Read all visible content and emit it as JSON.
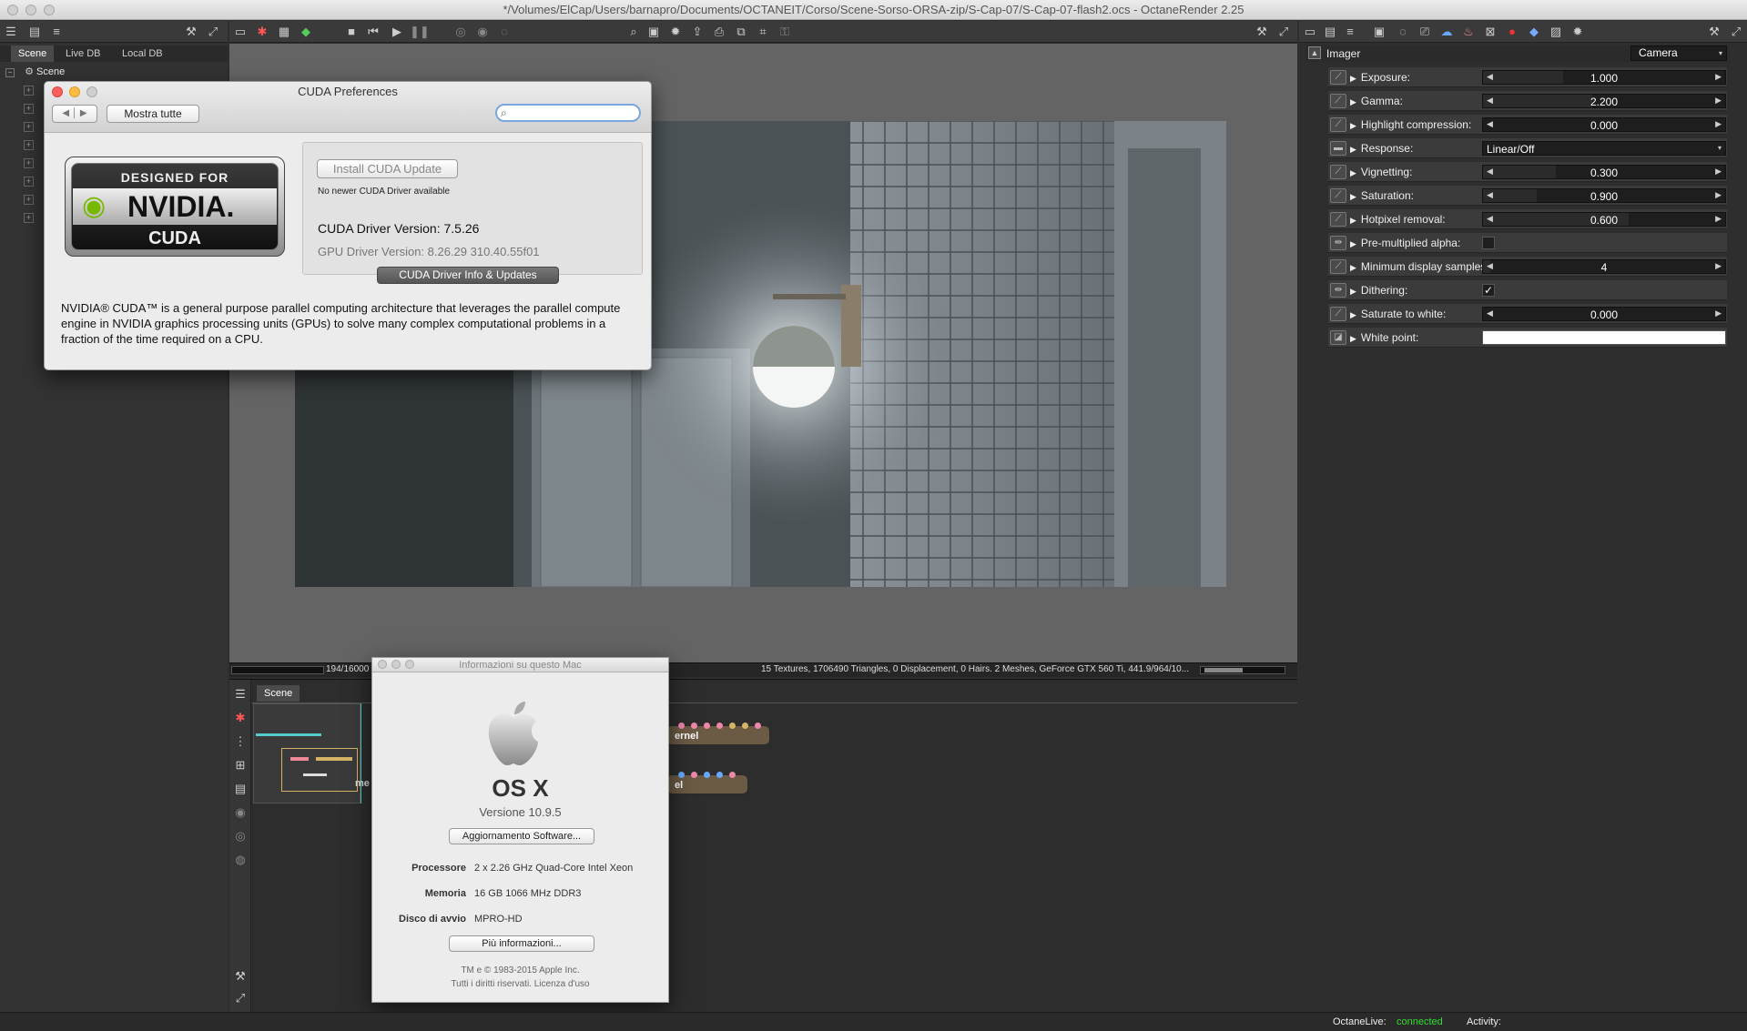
{
  "window": {
    "title": "*/Volumes/ElCap/Users/barnapro/Documents/OCTANEIT/Corso/Scene-Sorso-ORSA-zip/S-Cap-07/S-Cap-07-flash2.ocs - OctaneRender 2.25"
  },
  "scene_panel": {
    "tabs": [
      {
        "label": "Scene"
      },
      {
        "label": "Live DB"
      },
      {
        "label": "Local DB"
      }
    ],
    "root": "Scene"
  },
  "cuda_prefs": {
    "title": "CUDA Preferences",
    "show_all": "Mostra tutte",
    "search_placeholder": "",
    "logo": {
      "top": "DESIGNED FOR",
      "mid": "NVIDIA.",
      "bottom": "CUDA"
    },
    "install_button": "Install CUDA Update",
    "no_update": "No newer CUDA Driver available",
    "driver_version": "CUDA Driver Version: 7.5.26",
    "gpu_version": "GPU Driver Version: 8.26.29 310.40.55f01",
    "info_button": "CUDA Driver Info & Updates",
    "description": "NVIDIA® CUDA™ is a general purpose parallel computing architecture that leverages the parallel compute engine in NVIDIA graphics processing units (GPUs) to solve many complex computational problems in a fraction of the time required on a CPU."
  },
  "status_bar": {
    "samples": "194/16000",
    "stats": "15 Textures, 1706490 Triangles, 0 Displacement, 0 Hairs. 2 Meshes, GeForce GTX 560 Ti, 441.9/964/10..."
  },
  "graph_editor": {
    "tab": "Scene",
    "nodes": [
      {
        "label": "ernel"
      },
      {
        "label": "el"
      }
    ],
    "partial_label": "me"
  },
  "about_mac": {
    "title": "Informazioni su questo Mac",
    "os_name": "OS X",
    "version": "Versione 10.9.5",
    "update_button": "Aggiornamento Software...",
    "specs": [
      {
        "label": "Processore",
        "value": "2 x 2.26 GHz Quad-Core Intel Xeon"
      },
      {
        "label": "Memoria",
        "value": "16 GB 1066 MHz  DDR3"
      },
      {
        "label": "Disco di avvio",
        "value": "MPRO-HD"
      }
    ],
    "more_button": "Più informazioni...",
    "copyright1": "TM e © 1983-2015 Apple Inc.",
    "copyright2": "Tutti i diritti riservati.  Licenza d'uso"
  },
  "imager": {
    "header": "Imager",
    "camera_select": "Camera",
    "rows": [
      {
        "label": "Exposure:",
        "type": "slider",
        "value": "1.000",
        "fill": 0.33
      },
      {
        "label": "Gamma:",
        "type": "slider",
        "value": "2.200",
        "fill": 0.45
      },
      {
        "label": "Highlight compression:",
        "type": "slider",
        "value": "0.000",
        "fill": 0.0
      },
      {
        "label": "Response:",
        "type": "select",
        "value": "Linear/Off"
      },
      {
        "label": "Vignetting:",
        "type": "slider",
        "value": "0.300",
        "fill": 0.3
      },
      {
        "label": "Saturation:",
        "type": "slider",
        "value": "0.900",
        "fill": 0.22
      },
      {
        "label": "Hotpixel removal:",
        "type": "slider",
        "value": "0.600",
        "fill": 0.6
      },
      {
        "label": "Pre-multiplied alpha:",
        "type": "checkbox",
        "checked": false
      },
      {
        "label": "Minimum display samples:",
        "type": "slider",
        "value": "4",
        "fill": 0.03
      },
      {
        "label": "Dithering:",
        "type": "checkbox",
        "checked": true
      },
      {
        "label": "Saturate to white:",
        "type": "slider",
        "value": "0.000",
        "fill": 0.0
      },
      {
        "label": "White point:",
        "type": "color",
        "value": "#ffffff"
      }
    ]
  },
  "octane_live": {
    "label": "OctaneLive:",
    "status": "connected",
    "activity": "Activity:"
  },
  "colors": {
    "connected": "#33dd33",
    "node": "#6b5a44"
  }
}
